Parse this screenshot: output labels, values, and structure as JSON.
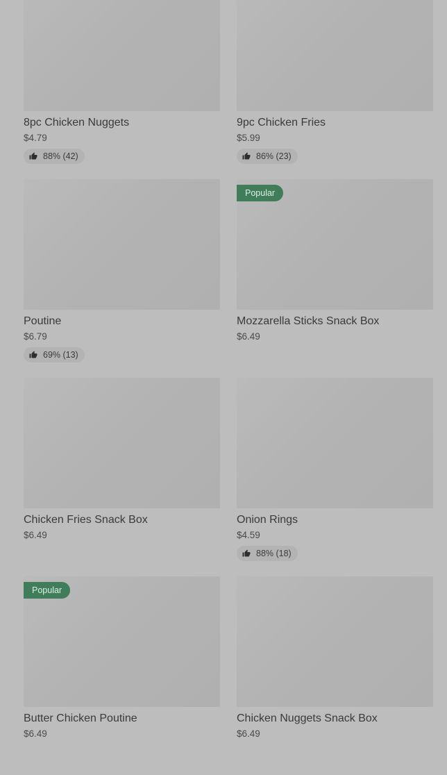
{
  "items": [
    {
      "name": "8pc Chicken Nuggets",
      "price": "$4.79",
      "rating": "88% (42)",
      "badge": ""
    },
    {
      "name": "9pc Chicken Fries",
      "price": "$5.99",
      "rating": "86% (23)",
      "badge": ""
    },
    {
      "name": "Poutine",
      "price": "$6.79",
      "rating": "69% (13)",
      "badge": ""
    },
    {
      "name": "Mozzarella Sticks Snack Box",
      "price": "$6.49",
      "rating": "",
      "badge": "Popular"
    },
    {
      "name": "Chicken Fries Snack Box",
      "price": "$6.49",
      "rating": "",
      "badge": ""
    },
    {
      "name": "Onion Rings",
      "price": "$4.59",
      "rating": "88% (18)",
      "badge": ""
    },
    {
      "name": "Butter Chicken Poutine",
      "price": "$6.49",
      "rating": "",
      "badge": "Popular"
    },
    {
      "name": "Chicken Nuggets Snack Box",
      "price": "$6.49",
      "rating": "",
      "badge": ""
    }
  ],
  "icons": {
    "thumbs_up": "thumbs-up-icon"
  }
}
